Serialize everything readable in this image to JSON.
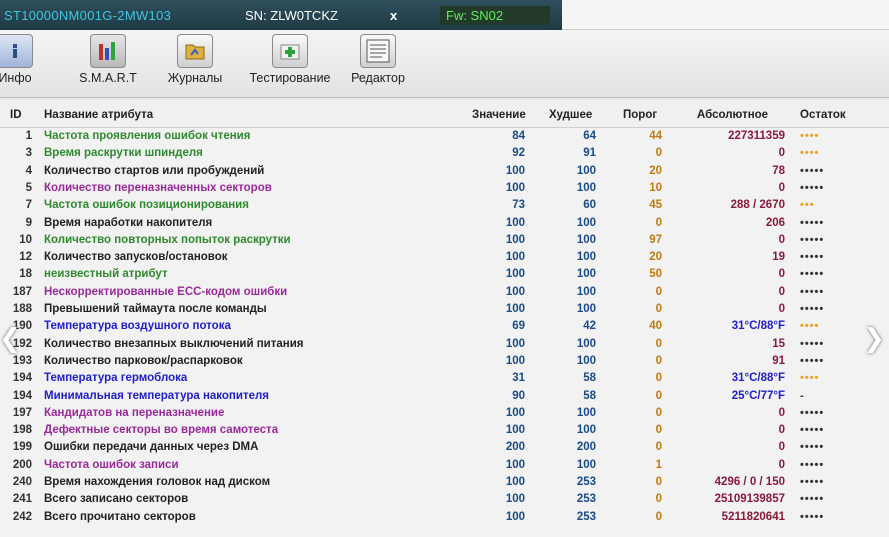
{
  "header": {
    "model": "ST10000NM001G-2MW103",
    "serial": "SN: ZLW0TCKZ",
    "close": "x",
    "firmware": "Fw: SN02"
  },
  "toolbar": {
    "items": [
      {
        "label": "Инфо",
        "icon": "info-icon"
      },
      {
        "label": "S.M.A.R.T",
        "icon": "smart-icon"
      },
      {
        "label": "Журналы",
        "icon": "logs-icon"
      },
      {
        "label": "Тестирование",
        "icon": "test-icon"
      },
      {
        "label": "Редактор",
        "icon": "hex-editor-icon"
      }
    ]
  },
  "table": {
    "headers": {
      "id": "ID",
      "name": "Название атрибута",
      "value": "Значение",
      "worst": "Худшее",
      "threshold": "Порог",
      "raw": "Абсолютное",
      "remaining": "Остаток"
    },
    "rows": [
      {
        "id": "1",
        "name": "Частота проявления ошибок чтения",
        "value": "84",
        "worst": "64",
        "threshold": "44",
        "raw": "227311359",
        "remaining": "••••",
        "color": "green",
        "raw_color": "red",
        "rem_color": "orange"
      },
      {
        "id": "3",
        "name": "Время раскрутки шпинделя",
        "value": "92",
        "worst": "91",
        "threshold": "0",
        "raw": "0",
        "remaining": "••••",
        "color": "green",
        "raw_color": "red",
        "rem_color": "orange"
      },
      {
        "id": "4",
        "name": "Количество стартов или пробуждений",
        "value": "100",
        "worst": "100",
        "threshold": "20",
        "raw": "78",
        "remaining": "•••••",
        "color": "dark",
        "raw_color": "red",
        "rem_color": "dark"
      },
      {
        "id": "5",
        "name": "Количество переназначенных секторов",
        "value": "100",
        "worst": "100",
        "threshold": "10",
        "raw": "0",
        "remaining": "•••••",
        "color": "purple",
        "raw_color": "red",
        "rem_color": "dark"
      },
      {
        "id": "7",
        "name": "Частота ошибок позиционирования",
        "value": "73",
        "worst": "60",
        "threshold": "45",
        "raw": "288 / 2670",
        "remaining": "•••",
        "color": "green",
        "raw_color": "red",
        "rem_color": "orange"
      },
      {
        "id": "9",
        "name": "Время наработки накопителя",
        "value": "100",
        "worst": "100",
        "threshold": "0",
        "raw": "206",
        "remaining": "•••••",
        "color": "dark",
        "raw_color": "red",
        "rem_color": "dark"
      },
      {
        "id": "10",
        "name": "Количество повторных попыток раскрутки",
        "value": "100",
        "worst": "100",
        "threshold": "97",
        "raw": "0",
        "remaining": "•••••",
        "color": "green",
        "raw_color": "red",
        "rem_color": "dark"
      },
      {
        "id": "12",
        "name": "Количество запусков/остановок",
        "value": "100",
        "worst": "100",
        "threshold": "20",
        "raw": "19",
        "remaining": "•••••",
        "color": "dark",
        "raw_color": "red",
        "rem_color": "dark"
      },
      {
        "id": "18",
        "name": "неизвестный атрибут",
        "value": "100",
        "worst": "100",
        "threshold": "50",
        "raw": "0",
        "remaining": "•••••",
        "color": "green",
        "raw_color": "red",
        "rem_color": "dark"
      },
      {
        "id": "187",
        "name": "Нескорректированные ECC-кодом ошибки",
        "value": "100",
        "worst": "100",
        "threshold": "0",
        "raw": "0",
        "remaining": "•••••",
        "color": "purple",
        "raw_color": "red",
        "rem_color": "dark"
      },
      {
        "id": "188",
        "name": "Превышений таймаута после команды",
        "value": "100",
        "worst": "100",
        "threshold": "0",
        "raw": "0",
        "remaining": "•••••",
        "color": "dark",
        "raw_color": "red",
        "rem_color": "dark"
      },
      {
        "id": "190",
        "name": "Температура воздушного потока",
        "value": "69",
        "worst": "42",
        "threshold": "40",
        "raw": "31°C/88°F",
        "remaining": "••••",
        "color": "blue",
        "raw_color": "blue",
        "rem_color": "orange"
      },
      {
        "id": "192",
        "name": "Количество внезапных выключений питания",
        "value": "100",
        "worst": "100",
        "threshold": "0",
        "raw": "15",
        "remaining": "•••••",
        "color": "dark",
        "raw_color": "red",
        "rem_color": "dark"
      },
      {
        "id": "193",
        "name": "Количество парковок/распарковок",
        "value": "100",
        "worst": "100",
        "threshold": "0",
        "raw": "91",
        "remaining": "•••••",
        "color": "dark",
        "raw_color": "red",
        "rem_color": "dark"
      },
      {
        "id": "194",
        "name": "Температура гермоблока",
        "value": "31",
        "worst": "58",
        "threshold": "0",
        "raw": "31°C/88°F",
        "remaining": "••••",
        "color": "blue",
        "raw_color": "blue",
        "rem_color": "orange"
      },
      {
        "id": "194",
        "name": "Минимальная температура накопителя",
        "value": "90",
        "worst": "58",
        "threshold": "0",
        "raw": "25°C/77°F",
        "remaining": "-",
        "color": "blue",
        "raw_color": "blue",
        "rem_color": "dark"
      },
      {
        "id": "197",
        "name": "Кандидатов на переназначение",
        "value": "100",
        "worst": "100",
        "threshold": "0",
        "raw": "0",
        "remaining": "•••••",
        "color": "purple",
        "raw_color": "red",
        "rem_color": "dark"
      },
      {
        "id": "198",
        "name": "Дефектные секторы во время самотеста",
        "value": "100",
        "worst": "100",
        "threshold": "0",
        "raw": "0",
        "remaining": "•••••",
        "color": "purple",
        "raw_color": "red",
        "rem_color": "dark"
      },
      {
        "id": "199",
        "name": "Ошибки передачи данных через DMA",
        "value": "200",
        "worst": "200",
        "threshold": "0",
        "raw": "0",
        "remaining": "•••••",
        "color": "dark",
        "raw_color": "red",
        "rem_color": "dark"
      },
      {
        "id": "200",
        "name": "Частота ошибок записи",
        "value": "100",
        "worst": "100",
        "threshold": "1",
        "raw": "0",
        "remaining": "•••••",
        "color": "purple",
        "raw_color": "red",
        "rem_color": "dark"
      },
      {
        "id": "240",
        "name": "Время нахождения головок над диском",
        "value": "100",
        "worst": "253",
        "threshold": "0",
        "raw": "4296 / 0 / 150",
        "remaining": "•••••",
        "color": "dark",
        "raw_color": "red",
        "rem_color": "dark"
      },
      {
        "id": "241",
        "name": "Всего записано секторов",
        "value": "100",
        "worst": "253",
        "threshold": "0",
        "raw": "25109139857",
        "remaining": "•••••",
        "color": "dark",
        "raw_color": "red",
        "rem_color": "dark"
      },
      {
        "id": "242",
        "name": "Всего прочитано секторов",
        "value": "100",
        "worst": "253",
        "threshold": "0",
        "raw": "5211820641",
        "remaining": "•••••",
        "color": "dark",
        "raw_color": "red",
        "rem_color": "dark"
      }
    ]
  },
  "nav": {
    "prev": "❮",
    "next": "❯"
  }
}
